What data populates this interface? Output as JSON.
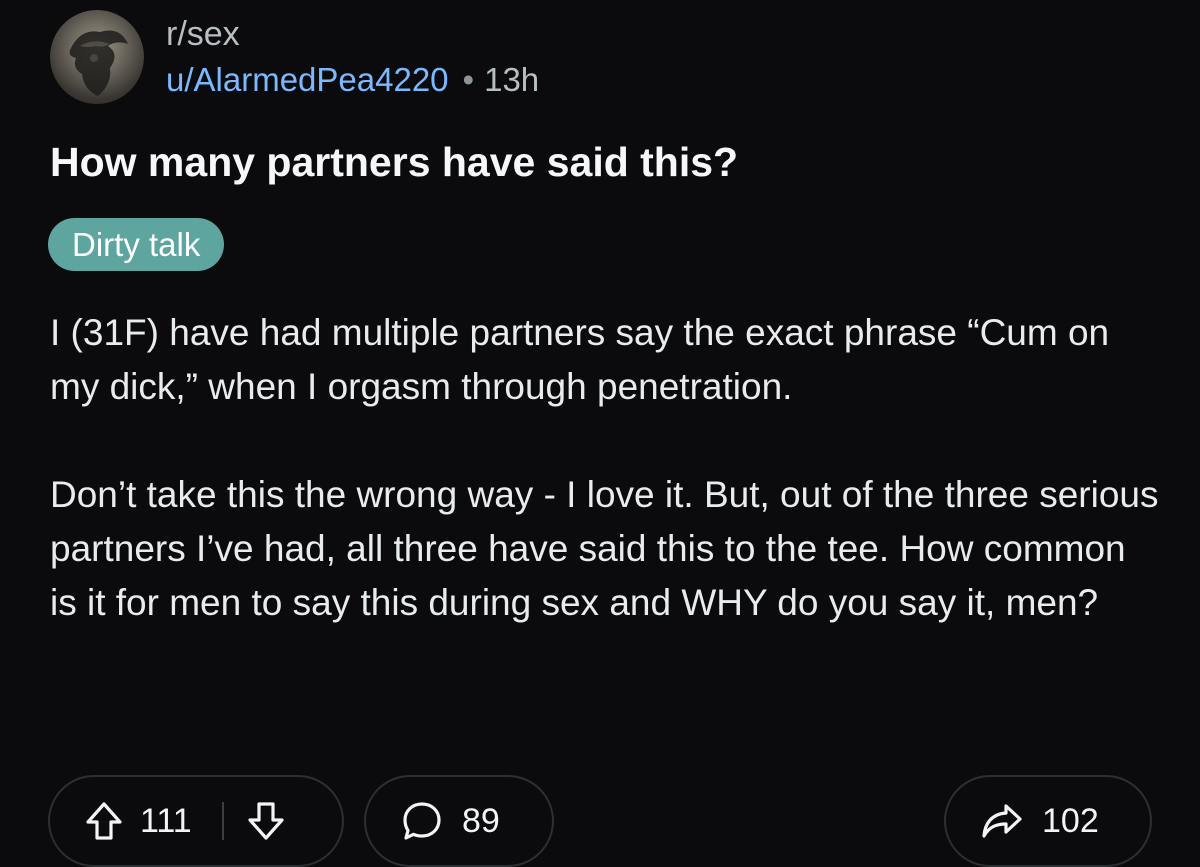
{
  "post": {
    "subreddit": "r/sex",
    "author": "u/AlarmedPea4220",
    "separator": "•",
    "age": "13h",
    "title": "How many partners have said this?",
    "flair": "Dirty talk",
    "body": [
      "I (31F) have had multiple partners say the exact phrase “Cum on my dick,” when I orgasm through penetration.",
      "Don’t take this the wrong way - I love it. But, out of the three serious partners I’ve had, all three have said this to the tee. How common is it for men to say this during sex and WHY do you say it, men?"
    ]
  },
  "actions": {
    "upvotes": "111",
    "comments": "89",
    "shares": "102"
  },
  "icons": {
    "avatar": "subreddit-avatar",
    "upvote": "arrow-up-icon",
    "downvote": "arrow-down-icon",
    "comment": "speech-bubble-icon",
    "share": "share-arrow-icon"
  },
  "colors": {
    "background": "#0b0b0d",
    "username": "#7ab9ff",
    "flair": "#5ea5a0",
    "meta": "#b7bfc3"
  }
}
